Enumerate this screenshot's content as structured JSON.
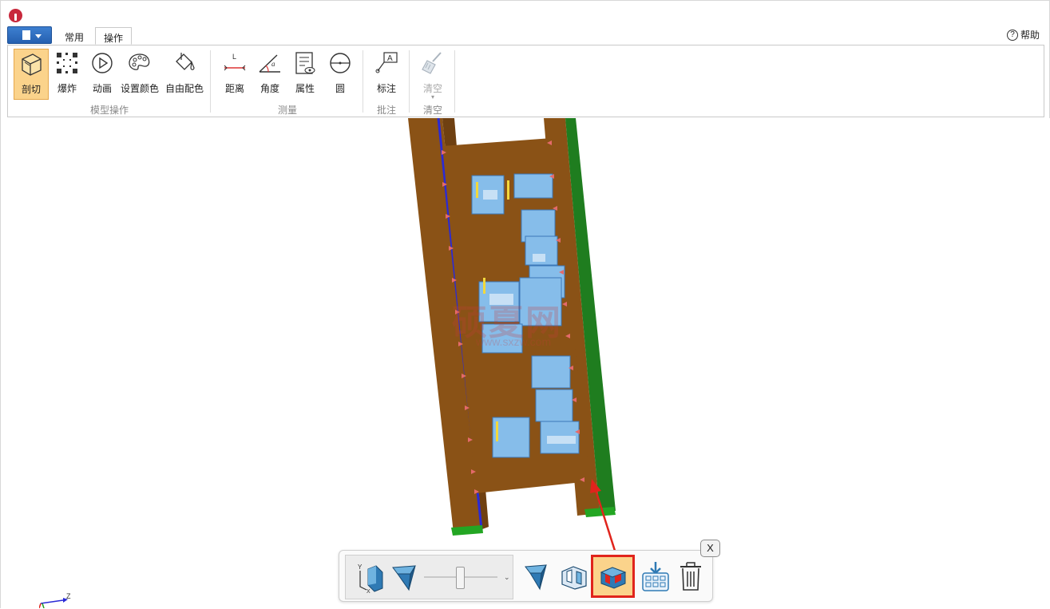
{
  "tabs": [
    {
      "label": "常用",
      "active": false
    },
    {
      "label": "操作",
      "active": true
    }
  ],
  "help": {
    "label": "帮助",
    "icon": "help-circle-icon"
  },
  "ribbon": {
    "groups": [
      {
        "label": "模型操作",
        "buttons": [
          {
            "label": "剖切",
            "icon": "section-cut-icon",
            "active": true
          },
          {
            "label": "爆炸",
            "icon": "explode-icon"
          },
          {
            "label": "动画",
            "icon": "play-icon"
          },
          {
            "label": "设置颜色",
            "icon": "palette-icon"
          },
          {
            "label": "自由配色",
            "icon": "paint-bucket-icon"
          }
        ]
      },
      {
        "label": "测量",
        "buttons": [
          {
            "label": "距离",
            "icon": "distance-icon"
          },
          {
            "label": "角度",
            "icon": "angle-icon"
          },
          {
            "label": "属性",
            "icon": "properties-icon"
          },
          {
            "label": "圆",
            "icon": "circle-icon"
          }
        ]
      },
      {
        "label": "批注",
        "buttons": [
          {
            "label": "标注",
            "icon": "annotation-icon"
          }
        ]
      },
      {
        "label": "清空",
        "buttons": [
          {
            "label": "清空",
            "icon": "broom-icon",
            "disabled": true
          }
        ]
      }
    ]
  },
  "watermark": {
    "title": "硕夏网",
    "subtitle": "www.sxzw.com"
  },
  "section_toolbar": {
    "close_label": "X",
    "axis_label_x": "X",
    "axis_label_y": "Y",
    "buttons": [
      {
        "icon": "axis-plane-icon"
      },
      {
        "icon": "section-plane-icon"
      },
      {
        "icon": "section-cap-icon"
      },
      {
        "icon": "section-outline-icon"
      },
      {
        "icon": "section-fill-icon",
        "selected": true
      },
      {
        "icon": "export-section-icon"
      },
      {
        "icon": "trash-icon"
      }
    ]
  },
  "coord_axes": {
    "z_label": "Z"
  },
  "colors": {
    "accent": "#fbd38b",
    "highlight": "#e0241c",
    "model_brown": "#8a5216",
    "model_green": "#1f7d1f",
    "model_blue": "#7eb5e6"
  }
}
